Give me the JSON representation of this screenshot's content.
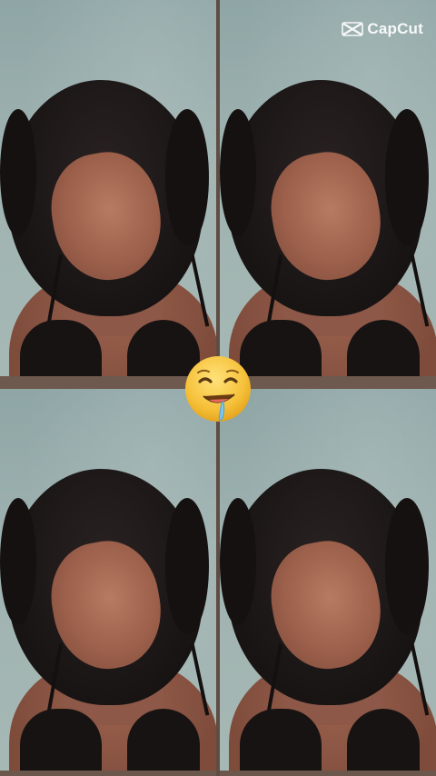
{
  "watermark": {
    "text": "CapCut",
    "icon": "capcut-logo-icon"
  },
  "overlay": {
    "emoji": "drooling-face-emoji",
    "emoji_glyph": "🤤"
  },
  "layout": {
    "tiles": [
      "photo-tile-1",
      "photo-tile-2",
      "photo-tile-3",
      "photo-tile-4"
    ]
  },
  "colors": {
    "wall": "#9fb3b1",
    "hair": "#1b1616",
    "skin": "#9c604b",
    "divider": "#6e594e",
    "emoji_yellow": "#f6c13a"
  }
}
